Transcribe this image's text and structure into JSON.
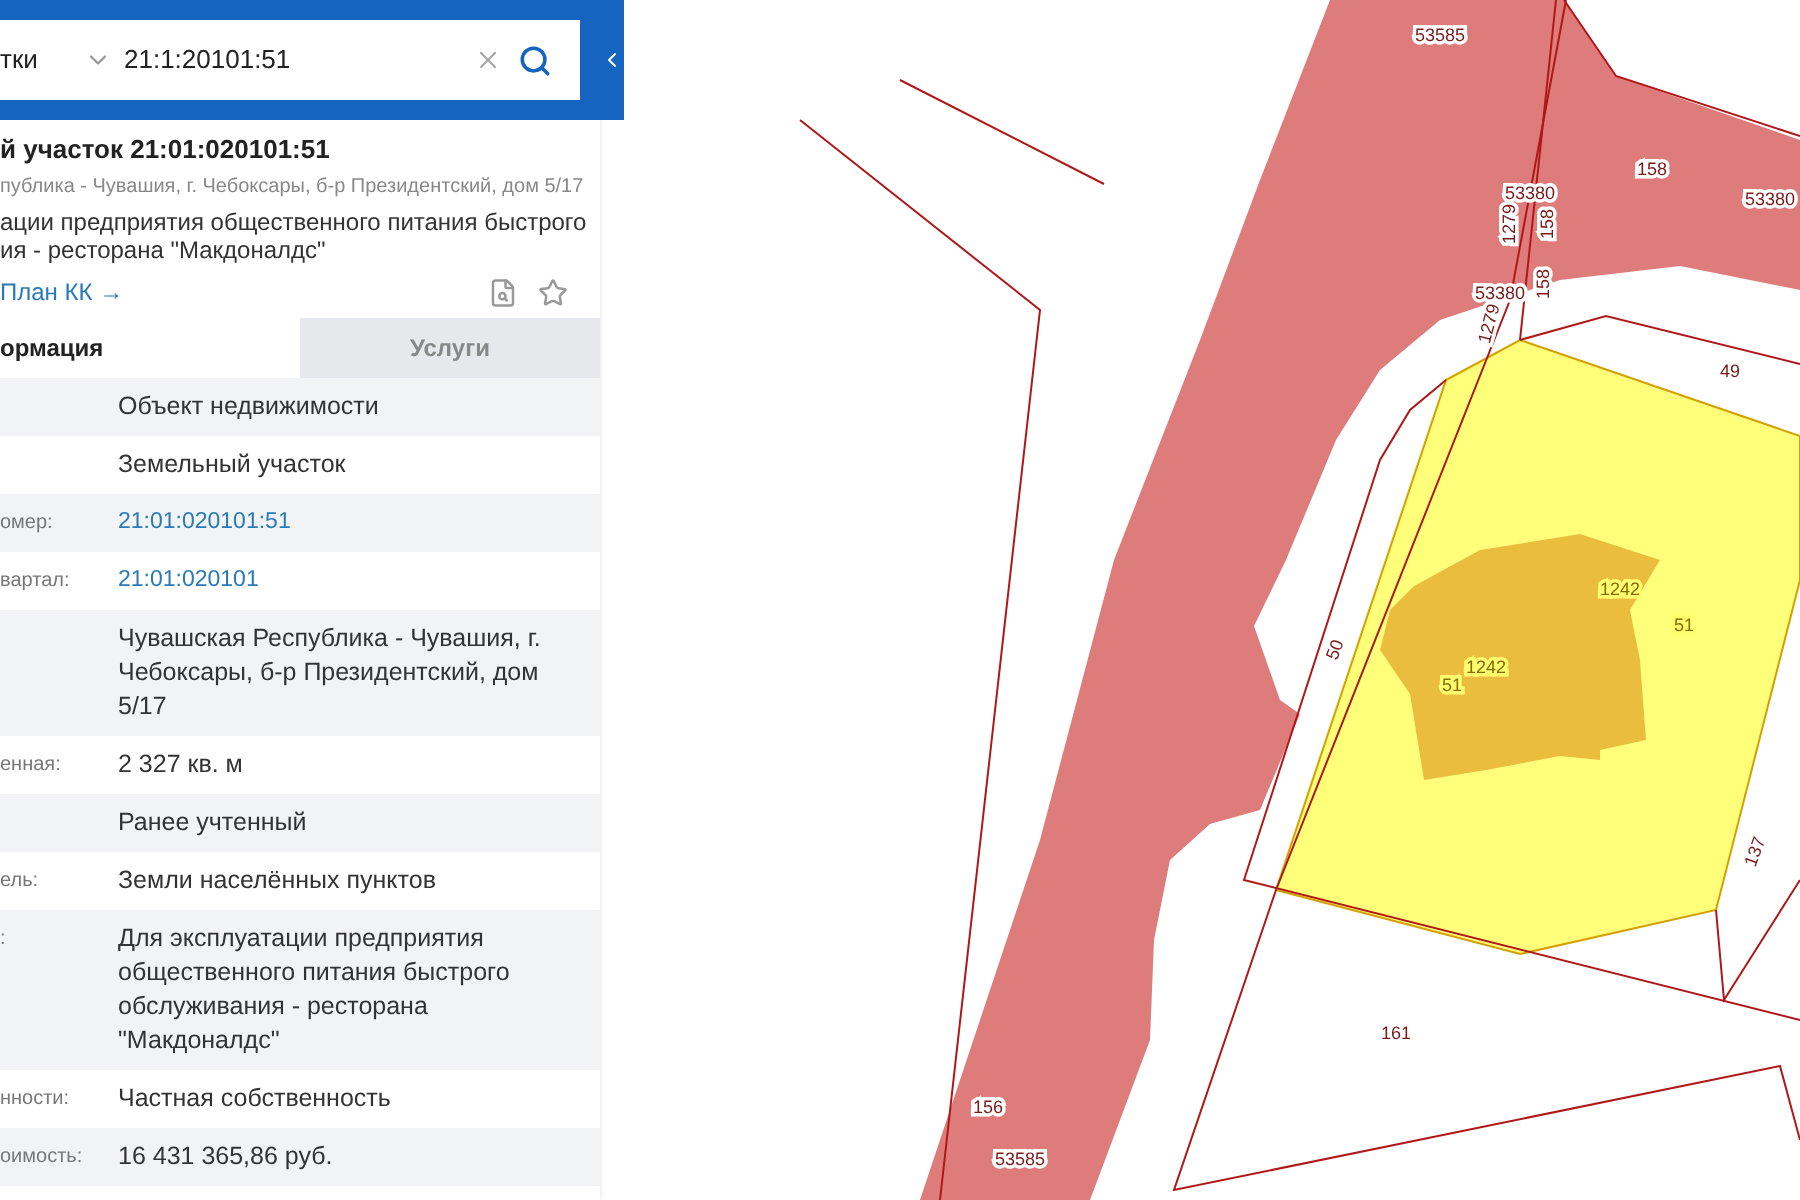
{
  "search": {
    "scope": "тки",
    "value": "21:1:20101:51"
  },
  "object": {
    "title": "й участок 21:01:020101:51",
    "address": "публика - Чувашия, г. Чебоксары, б-р Президентский, дом 5/17",
    "description_lines": [
      "ации предприятия общественного питания быстрого",
      "ия - ресторана \"Макдоналдс\""
    ],
    "link": "План КК →"
  },
  "tabs": [
    {
      "label": "ормация",
      "selected": true
    },
    {
      "label": "Услуги",
      "selected": false
    }
  ],
  "rows": [
    {
      "kind": "text",
      "value": "Объект недвижимости"
    },
    {
      "kind": "text",
      "value": "Земельный участок"
    },
    {
      "kind": "link",
      "label": "омер:",
      "value": "21:01:020101:51"
    },
    {
      "kind": "link",
      "label": "вартал:",
      "value": "21:01:020101"
    },
    {
      "kind": "text",
      "value": "Чувашская Республика - Чувашия, г. Чебоксары, б-р Президентский, дом 5/17"
    },
    {
      "kind": "text",
      "label": "енная:",
      "value": "2 327 кв. м"
    },
    {
      "kind": "text",
      "value": "Ранее учтенный"
    },
    {
      "kind": "text",
      "label": "ель:",
      "value": "Земли населённых пунктов"
    },
    {
      "kind": "text",
      "label": ":",
      "value": "Для эксплуатации предприятия общественного питания быстрого обслуживания - ресторана \"Макдоналдс\""
    },
    {
      "kind": "text",
      "label": "нности:",
      "value": "Частная собственность"
    },
    {
      "kind": "text",
      "label": "оимость:",
      "value": "16 431 365,86 руб."
    }
  ],
  "map": {
    "labels": [
      "53585",
      "158",
      "53380",
      "53380",
      "1279",
      "158",
      "53380",
      "1279",
      "158",
      "49",
      "50",
      "1242",
      "51",
      "1242",
      "51",
      "137",
      "161",
      "156",
      "53585"
    ]
  }
}
